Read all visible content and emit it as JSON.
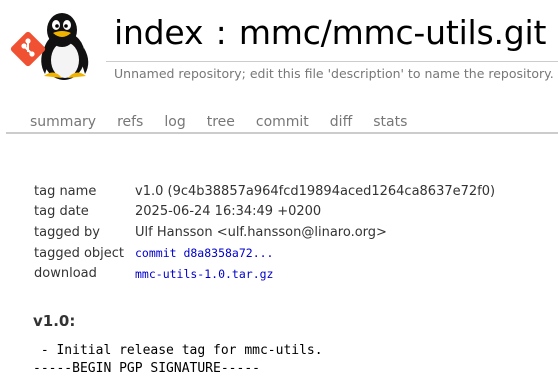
{
  "header": {
    "title_prefix": "index",
    "title_sep": ":",
    "repo_name": "mmc/mmc-utils.git",
    "description": "Unnamed repository; edit this file 'description' to name the repository.",
    "logo_icon": "git-penguin-logo"
  },
  "tabs": [
    {
      "label": "summary"
    },
    {
      "label": "refs"
    },
    {
      "label": "log"
    },
    {
      "label": "tree"
    },
    {
      "label": "commit"
    },
    {
      "label": "diff"
    },
    {
      "label": "stats"
    }
  ],
  "tag_info": {
    "tag_name_label": "tag name",
    "tag_name_value": "v1.0 (9c4b38857a964fcd19894aced1264ca8637e72f0)",
    "tag_date_label": "tag date",
    "tag_date_value": "2025-06-24 16:34:49 +0200",
    "tagged_by_label": "tagged by",
    "tagged_by_value": "Ulf Hansson <ulf.hansson@linaro.org>",
    "tagged_object_label": "tagged object",
    "tagged_object_value": "commit d8a8358a72...",
    "download_label": "download",
    "download_value": "mmc-utils-1.0.tar.gz"
  },
  "tag_heading": "v1.0:",
  "message_lines": [
    " - Initial release tag for mmc-utils.",
    "-----BEGIN PGP SIGNATURE-----"
  ],
  "colors": {
    "link": "#0000cc",
    "tab_text": "#777777",
    "divider": "#cccccc",
    "git_logo": "#f05133"
  }
}
